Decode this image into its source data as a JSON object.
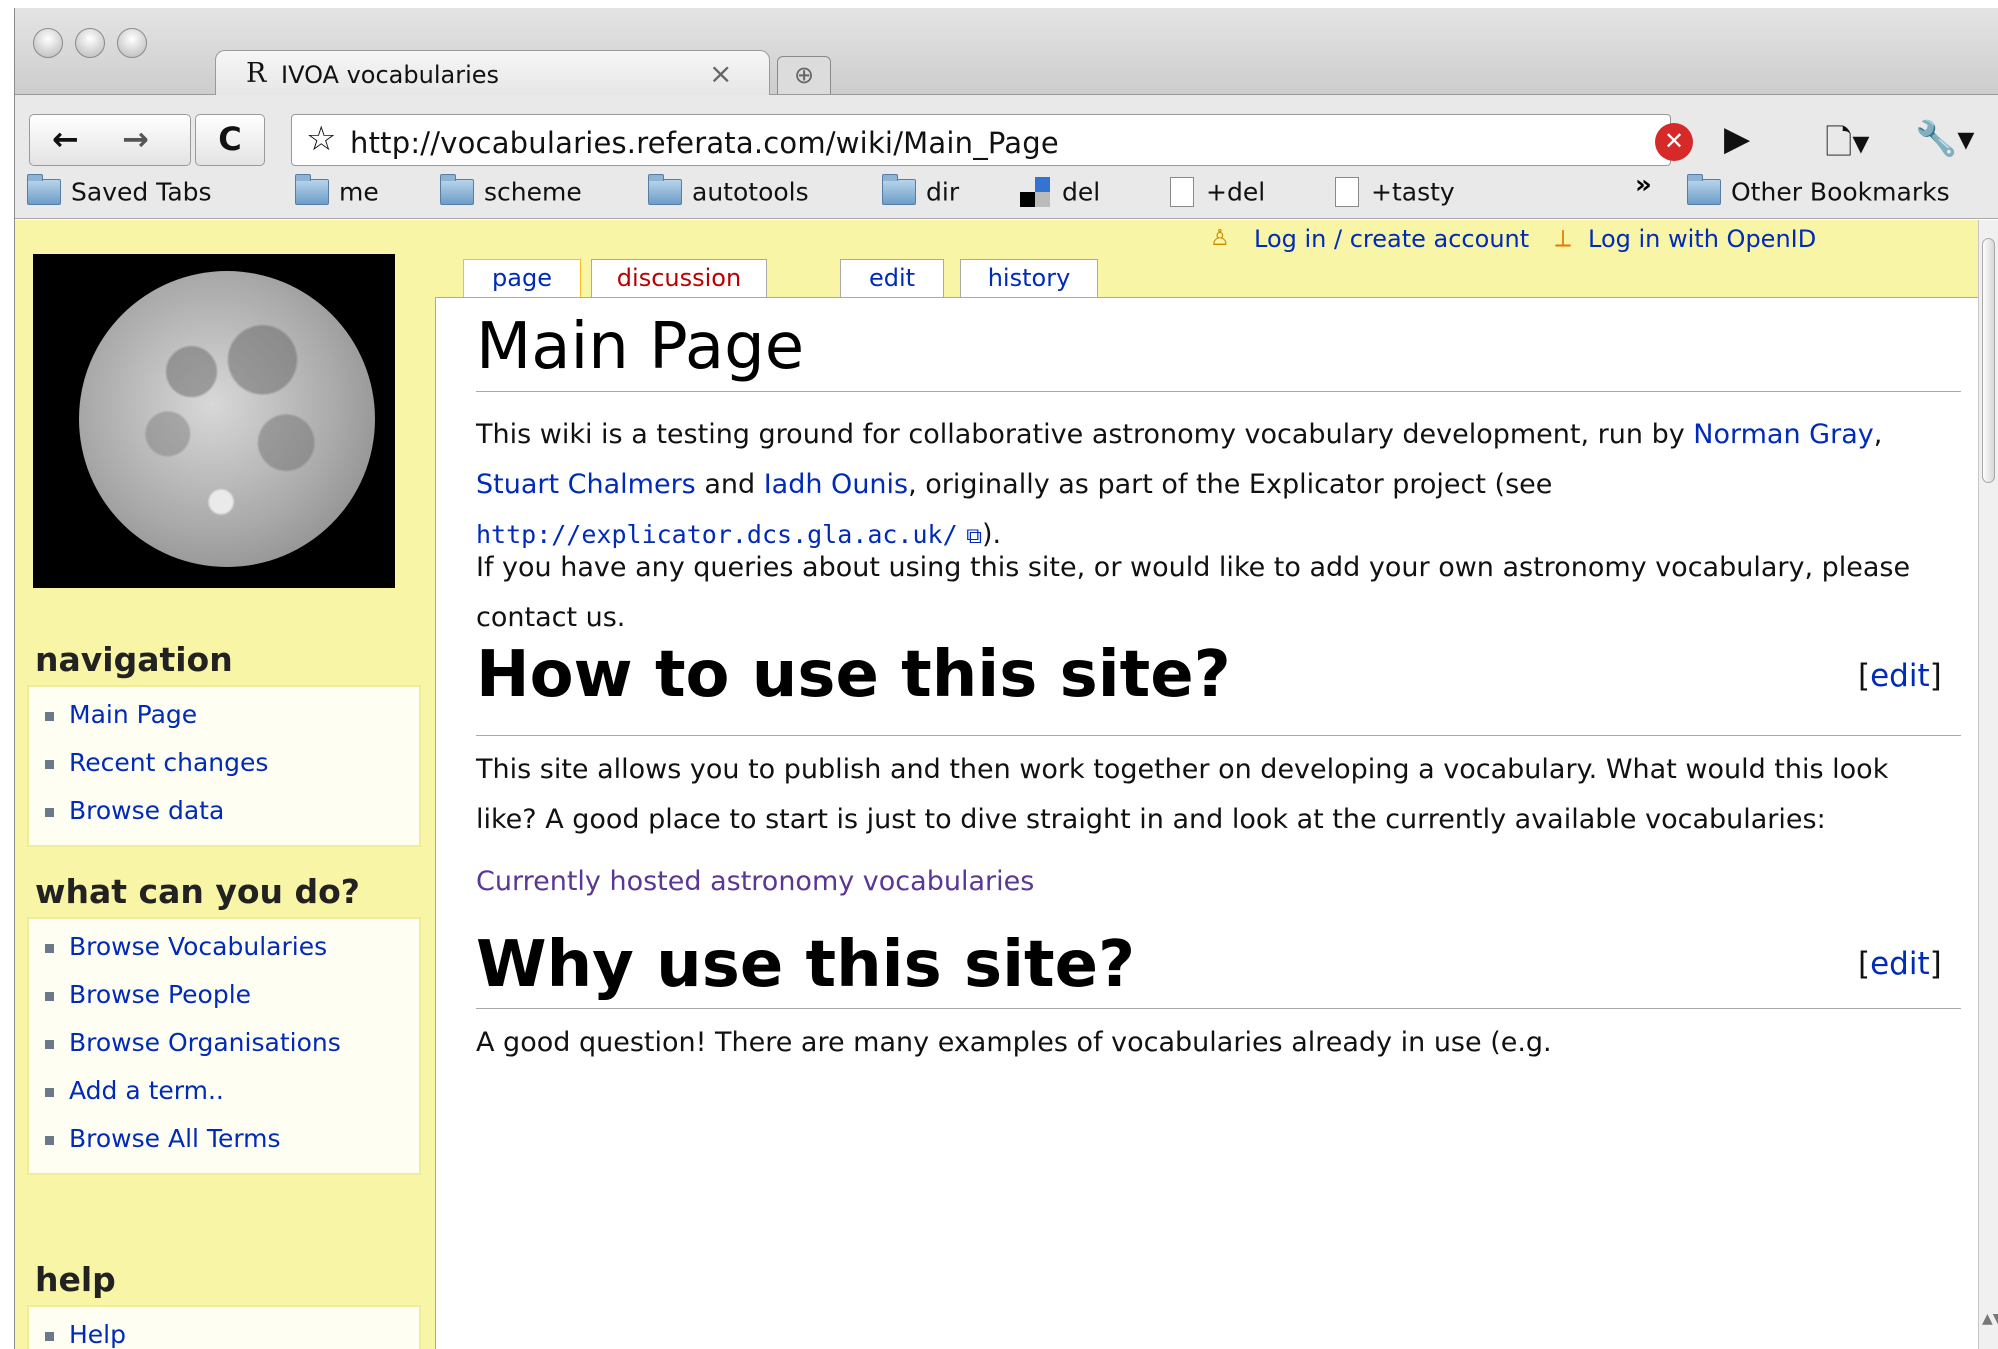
{
  "browser": {
    "tab_favicon": "R",
    "tab_title": "IVOA vocabularies",
    "tab_close": "×",
    "new_tab": "⊕",
    "url": "http://vocabularies.referata.com/wiki/Main_Page",
    "back_icon": "←",
    "forward_icon": "→",
    "reload_icon": "C",
    "star_icon": "☆",
    "blocker_icon": "✕",
    "play_icon": "▶",
    "page_menu_icon": "🗋▾",
    "wrench_icon": "🔧▾",
    "bookmarks": [
      {
        "label": "Saved Tabs",
        "icon": "folder-icon"
      },
      {
        "label": "me",
        "icon": "folder-icon"
      },
      {
        "label": "scheme",
        "icon": "folder-icon"
      },
      {
        "label": "autotools",
        "icon": "folder-icon"
      },
      {
        "label": "dir",
        "icon": "folder-icon"
      },
      {
        "label": "del",
        "icon": "delicious-icon"
      },
      {
        "label": "+del",
        "icon": "page-icon"
      },
      {
        "label": "+tasty",
        "icon": "page-icon"
      }
    ],
    "bookmarks_more": "»",
    "other_bookmarks": "Other Bookmarks"
  },
  "personal_tools": {
    "login": "Log in / create account",
    "openid": "Log in with OpenID"
  },
  "page_tabs": {
    "page": "page",
    "discussion": "discussion",
    "edit": "edit",
    "history": "history"
  },
  "sidebar": {
    "navigation": {
      "title": "navigation",
      "items": [
        "Main Page",
        "Recent changes",
        "Browse data"
      ]
    },
    "what_can_you_do": {
      "title": "what can you do?",
      "items": [
        "Browse Vocabularies",
        "Browse People",
        "Browse Organisations",
        "Add a term..",
        "Browse All Terms"
      ]
    },
    "help": {
      "title": "help",
      "items": [
        "Help"
      ]
    }
  },
  "content": {
    "title": "Main Page",
    "intro": {
      "text1": "This wiki is a testing ground for collaborative astronomy vocabulary development, run by",
      "name1": "Norman Gray",
      "sep1": ", ",
      "name2": "Stuart Chalmers",
      "sep2": " and ",
      "name3": "Iadh Ounis",
      "text2": ", originally as part of the Explicator project (see",
      "url": "http://explicator.dcs.gla.ac.uk/",
      "url_suffix": ")."
    },
    "contact": "If you have any queries about using this site, or would like to add your own astronomy vocabulary, please contact us.",
    "section1": {
      "heading": "How to use this site?",
      "edit_open": "[",
      "edit_label": "edit",
      "edit_close": "]",
      "text": "This site allows you to publish and then work together on developing a vocabulary. What would this look like? A good place to start is just to dive straight in and look at the currently available vocabularies:",
      "link": "Currently hosted astronomy vocabularies"
    },
    "section2": {
      "heading": "Why use this site?",
      "edit_open": "[",
      "edit_label": "edit",
      "edit_close": "]",
      "text": "A good question! There are many examples of vocabularies already in use (e.g."
    }
  },
  "colors": {
    "page_bg": "#f8f5a6",
    "link": "#002bb8",
    "new_link": "#ba0000",
    "visited": "#5a3696"
  }
}
